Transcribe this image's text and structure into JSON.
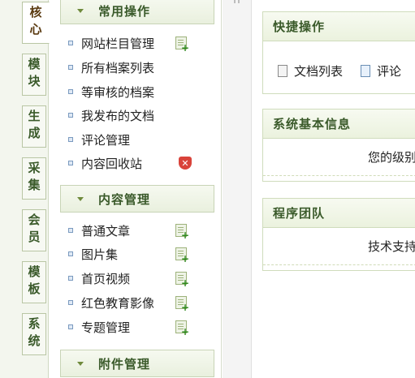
{
  "tabs": [
    {
      "label": "核心",
      "active": true
    },
    {
      "label": "模块",
      "active": false
    },
    {
      "label": "生成",
      "active": false
    },
    {
      "label": "采集",
      "active": false
    },
    {
      "label": "会员",
      "active": false
    },
    {
      "label": "模板",
      "active": false
    },
    {
      "label": "系统",
      "active": false
    }
  ],
  "menu": {
    "sections": [
      {
        "title": "常用操作"
      },
      {
        "title": "内容管理"
      },
      {
        "title": "附件管理"
      }
    ],
    "common_items": [
      {
        "label": "网站栏目管理",
        "icon": "add-doc-icon"
      },
      {
        "label": "所有档案列表"
      },
      {
        "label": "等审核的档案"
      },
      {
        "label": "我发布的文档"
      },
      {
        "label": "评论管理"
      },
      {
        "label": "内容回收站",
        "icon": "delete-icon"
      }
    ],
    "content_items": [
      {
        "label": "普通文章",
        "icon": "add-doc-icon"
      },
      {
        "label": "图片集",
        "icon": "add-doc-icon"
      },
      {
        "label": "首页视频",
        "icon": "add-doc-icon"
      },
      {
        "label": "红色教育影像",
        "icon": "add-doc-icon"
      },
      {
        "label": "专题管理",
        "icon": "add-doc-icon"
      }
    ]
  },
  "main": {
    "quick_panel": {
      "title": "快捷操作",
      "actions": [
        {
          "label": "文档列表",
          "icon": "document-icon"
        },
        {
          "label": "评论",
          "icon": "comment-icon"
        }
      ]
    },
    "sysinfo_panel": {
      "title": "系统基本信息",
      "text": "您的级别"
    },
    "team_panel": {
      "title": "程序团队",
      "text": "技术支持"
    }
  },
  "colors": {
    "accent_green": "#3a5a2a",
    "panel_border": "#cfdcbc",
    "delete_red": "#d9433a"
  }
}
